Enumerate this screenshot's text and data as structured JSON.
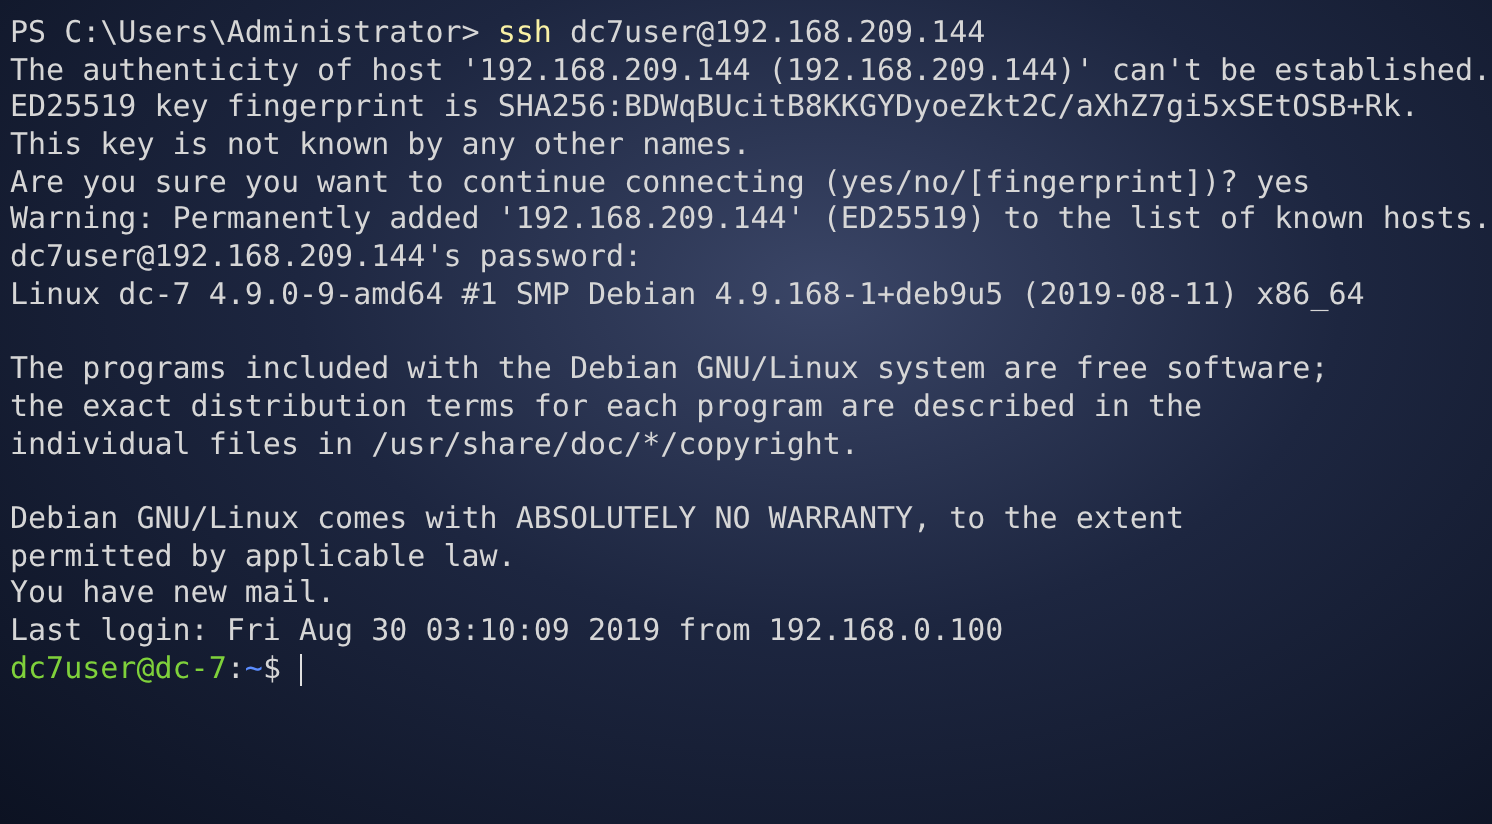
{
  "terminal": {
    "lines": [
      {
        "kind": "command",
        "prompt": "PS C:\\Users\\Administrator>",
        "command": "ssh",
        "args": "dc7user@192.168.209.144"
      },
      {
        "kind": "output",
        "text": "The authenticity of host '192.168.209.144 (192.168.209.144)' can't be established."
      },
      {
        "kind": "output",
        "text": "ED25519 key fingerprint is SHA256:BDWqBUcitB8KKGYDyoeZkt2C/aXhZ7gi5xSEtOSB+Rk."
      },
      {
        "kind": "output",
        "text": "This key is not known by any other names."
      },
      {
        "kind": "output",
        "text": "Are you sure you want to continue connecting (yes/no/[fingerprint])? yes"
      },
      {
        "kind": "output",
        "text": "Warning: Permanently added '192.168.209.144' (ED25519) to the list of known hosts."
      },
      {
        "kind": "output",
        "text": "dc7user@192.168.209.144's password:"
      },
      {
        "kind": "output",
        "text": "Linux dc-7 4.9.0-9-amd64 #1 SMP Debian 4.9.168-1+deb9u5 (2019-08-11) x86_64"
      },
      {
        "kind": "blank"
      },
      {
        "kind": "output",
        "text": "The programs included with the Debian GNU/Linux system are free software;"
      },
      {
        "kind": "output",
        "text": "the exact distribution terms for each program are described in the"
      },
      {
        "kind": "output",
        "text": "individual files in /usr/share/doc/*/copyright."
      },
      {
        "kind": "blank"
      },
      {
        "kind": "output",
        "text": "Debian GNU/Linux comes with ABSOLUTELY NO WARRANTY, to the extent"
      },
      {
        "kind": "output",
        "text": "permitted by applicable law."
      },
      {
        "kind": "output",
        "text": "You have new mail."
      },
      {
        "kind": "output",
        "text": "Last login: Fri Aug 30 03:10:09 2019 from 192.168.0.100"
      },
      {
        "kind": "prompt",
        "user_host": "dc7user@dc-7",
        "separator": ":",
        "path": "~",
        "symbol": "$"
      }
    ]
  }
}
